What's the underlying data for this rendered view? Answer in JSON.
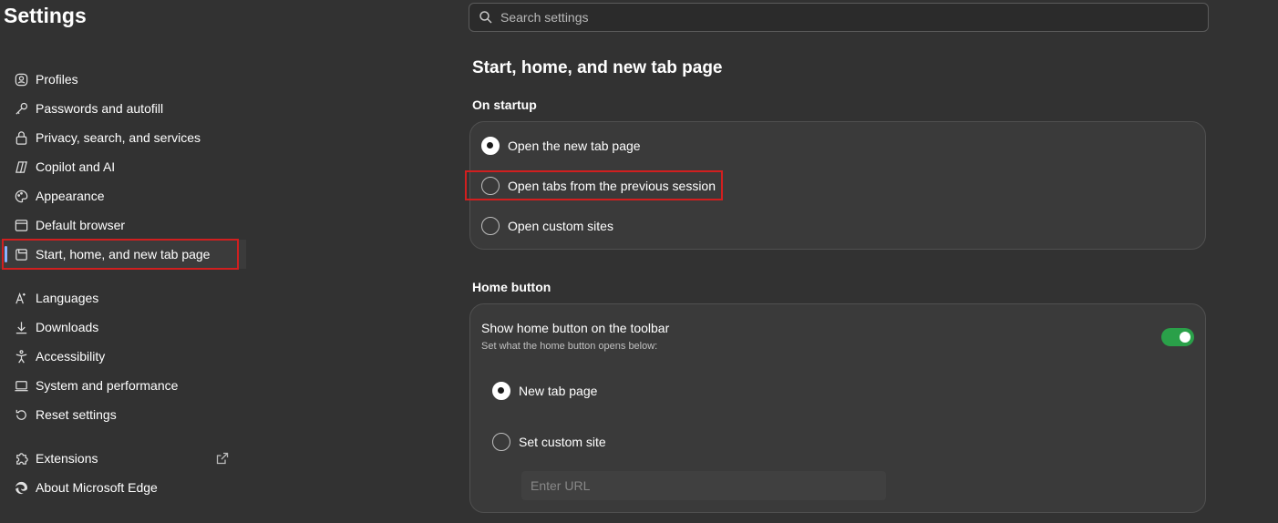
{
  "app": {
    "title": "Settings"
  },
  "search": {
    "placeholder": "Search settings"
  },
  "nav": {
    "items": [
      {
        "label": "Profiles",
        "icon": "profile-icon"
      },
      {
        "label": "Passwords and autofill",
        "icon": "key-icon"
      },
      {
        "label": "Privacy, search, and services",
        "icon": "lock-icon"
      },
      {
        "label": "Copilot and AI",
        "icon": "copilot-icon"
      },
      {
        "label": "Appearance",
        "icon": "palette-icon"
      },
      {
        "label": "Default browser",
        "icon": "browser-icon"
      },
      {
        "label": "Start, home, and new tab page",
        "icon": "home-tab-icon",
        "selected": true
      }
    ],
    "items2": [
      {
        "label": "Languages",
        "icon": "languages-icon"
      },
      {
        "label": "Downloads",
        "icon": "download-icon"
      },
      {
        "label": "Accessibility",
        "icon": "accessibility-icon"
      },
      {
        "label": "System and performance",
        "icon": "laptop-icon"
      },
      {
        "label": "Reset settings",
        "icon": "reset-icon"
      }
    ],
    "items3": [
      {
        "label": "Extensions",
        "icon": "puzzle-icon",
        "external": "external-link-icon"
      },
      {
        "label": "About Microsoft Edge",
        "icon": "edge-icon"
      }
    ]
  },
  "main": {
    "title": "Start, home, and new tab page",
    "startup": {
      "label": "On startup",
      "options": [
        {
          "label": "Open the new tab page",
          "checked": true
        },
        {
          "label": "Open tabs from the previous session",
          "checked": false
        },
        {
          "label": "Open custom sites",
          "checked": false
        }
      ]
    },
    "home": {
      "label": "Home button",
      "show_label": "Show home button on the toolbar",
      "show_sub": "Set what the home button opens below:",
      "toggle_on": true,
      "options": [
        {
          "label": "New tab page",
          "checked": true
        },
        {
          "label": "Set custom site",
          "checked": false
        }
      ],
      "url_placeholder": "Enter URL"
    }
  },
  "colors": {
    "highlight": "#d11f1f",
    "toggle": "#2aa049",
    "accent": "#8ab4ff"
  }
}
